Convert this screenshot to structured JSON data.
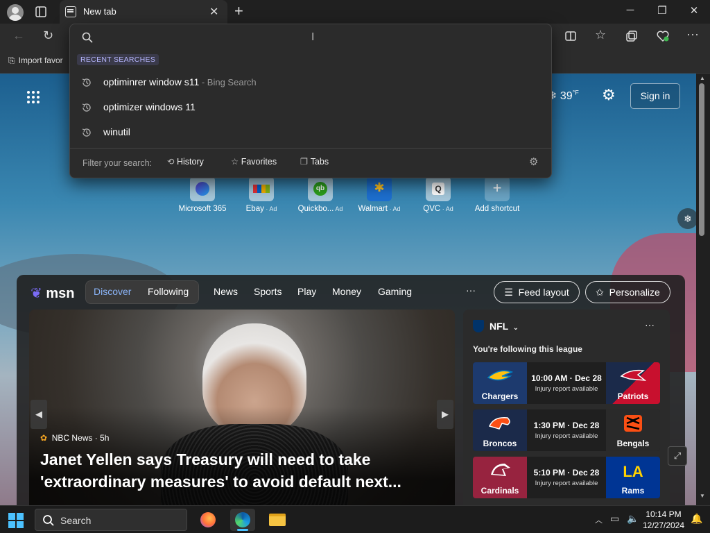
{
  "browser": {
    "tab_title": "New tab",
    "favorites_bar_item": "Import favor",
    "window_controls": [
      "minimize-icon",
      "restore-icon",
      "close-icon"
    ]
  },
  "search_dropdown": {
    "input_value": "",
    "section_header": "RECENT SEARCHES",
    "items": [
      {
        "text": "optiminrer window s11",
        "suffix": " - Bing Search"
      },
      {
        "text": "optimizer windows 11",
        "suffix": ""
      },
      {
        "text": "winutil",
        "suffix": ""
      }
    ],
    "filter_label": "Filter your search:",
    "filters": [
      "History",
      "Favorites",
      "Tabs"
    ]
  },
  "newtab": {
    "temperature": "39",
    "temp_unit": "°F",
    "sign_in": "Sign in",
    "quick_links": [
      {
        "label": "Microsoft 365",
        "ad": ""
      },
      {
        "label": "Ebay",
        "ad": " · Ad"
      },
      {
        "label": "Quickbo...",
        "ad": "  Ad"
      },
      {
        "label": "Walmart",
        "ad": " · Ad"
      },
      {
        "label": "QVC",
        "ad": " · Ad"
      },
      {
        "label": "Add shortcut",
        "ad": ""
      }
    ]
  },
  "feed": {
    "brand": "msn",
    "nav": [
      "Discover",
      "Following",
      "News",
      "Sports",
      "Play",
      "Money",
      "Gaming"
    ],
    "more": "···",
    "feed_layout": "Feed layout",
    "personalize": "Personalize",
    "hero": {
      "source": "NBC News · 5h",
      "title": "Janet Yellen says Treasury will need to take 'extraordinary measures' to avoid default next..."
    },
    "nfl": {
      "title": "NFL",
      "subtitle": "You're following this league",
      "more": "···",
      "games": [
        {
          "left": "Chargers",
          "right": "Patriots",
          "time": "10:00 AM · Dec 28",
          "info": "Injury report available",
          "left_color": "#1d3a6e",
          "right_color": "#c8102e"
        },
        {
          "left": "Broncos",
          "right": "Bengals",
          "time": "1:30 PM · Dec 28",
          "info": "Injury report available",
          "left_color": "#1b2a4a",
          "right_color": "#2a2a2a"
        },
        {
          "left": "Cardinals",
          "right": "Rams",
          "time": "5:10 PM · Dec 28",
          "info": "Injury report available",
          "left_color": "#97233f",
          "right_color": "#003594"
        }
      ]
    }
  },
  "taskbar": {
    "search_label": "Search",
    "time": "10:14 PM",
    "date": "12/27/2024"
  }
}
